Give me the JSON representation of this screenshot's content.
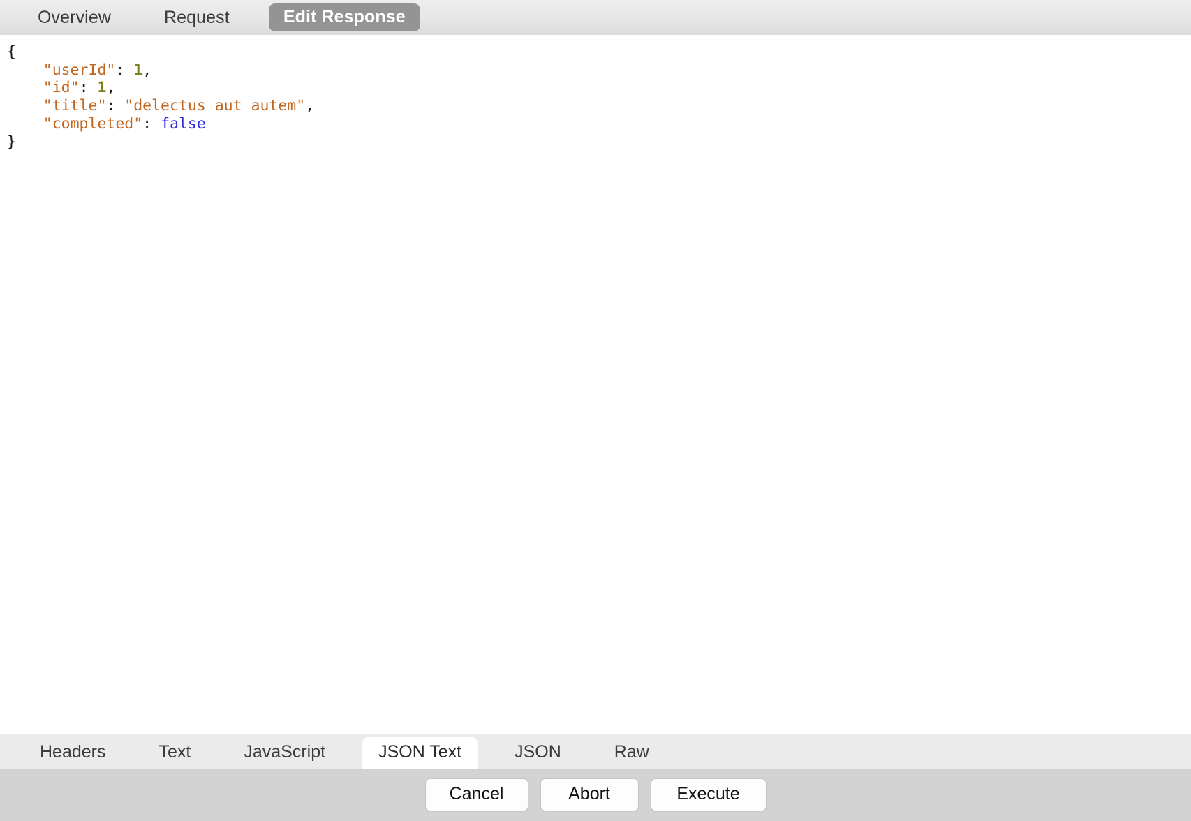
{
  "top_tabs": [
    {
      "label": "Overview",
      "active": false
    },
    {
      "label": "Request",
      "active": false
    },
    {
      "label": "Edit Response",
      "active": true
    }
  ],
  "editor": {
    "language": "json",
    "lines": [
      {
        "tokens": [
          {
            "t": "punct",
            "v": "{"
          }
        ]
      },
      {
        "tokens": [
          {
            "t": "punct",
            "v": "    "
          },
          {
            "t": "key",
            "v": "\"userId\""
          },
          {
            "t": "punct",
            "v": ": "
          },
          {
            "t": "num",
            "v": "1"
          },
          {
            "t": "punct",
            "v": ","
          }
        ]
      },
      {
        "tokens": [
          {
            "t": "punct",
            "v": "    "
          },
          {
            "t": "key",
            "v": "\"id\""
          },
          {
            "t": "punct",
            "v": ": "
          },
          {
            "t": "num",
            "v": "1"
          },
          {
            "t": "punct",
            "v": ","
          }
        ]
      },
      {
        "tokens": [
          {
            "t": "punct",
            "v": "    "
          },
          {
            "t": "key",
            "v": "\"title\""
          },
          {
            "t": "punct",
            "v": ": "
          },
          {
            "t": "str",
            "v": "\"delectus aut autem\""
          },
          {
            "t": "punct",
            "v": ","
          }
        ]
      },
      {
        "tokens": [
          {
            "t": "punct",
            "v": "    "
          },
          {
            "t": "key",
            "v": "\"completed\""
          },
          {
            "t": "punct",
            "v": ": "
          },
          {
            "t": "bool",
            "v": "false"
          }
        ]
      },
      {
        "tokens": [
          {
            "t": "punct",
            "v": "}"
          }
        ]
      }
    ],
    "plain_text": "{\n    \"userId\": 1,\n    \"id\": 1,\n    \"title\": \"delectus aut autem\",\n    \"completed\": false\n}"
  },
  "format_tabs": [
    {
      "label": "Headers",
      "active": false
    },
    {
      "label": "Text",
      "active": false
    },
    {
      "label": "JavaScript",
      "active": false
    },
    {
      "label": "JSON Text",
      "active": true
    },
    {
      "label": "JSON",
      "active": false
    },
    {
      "label": "Raw",
      "active": false
    }
  ],
  "footer_buttons": [
    {
      "label": "Cancel",
      "kind": "cancel"
    },
    {
      "label": "Abort",
      "kind": "abort"
    },
    {
      "label": "Execute",
      "kind": "execute"
    }
  ],
  "colors": {
    "top_bar_top": "#ededed",
    "top_bar_bottom": "#dcdcdc",
    "active_top_tab_bg": "#949494",
    "active_top_tab_fg": "#ffffff",
    "tab_strip_bg": "#ebebeb",
    "active_fmt_tab_bg": "#ffffff",
    "footer_bg": "#d3d3d3",
    "button_bg": "#fdfdfd",
    "editor_bg": "#ffffff",
    "syntax_key": "#c2651f",
    "syntax_string": "#c2651f",
    "syntax_number": "#7f7f1b",
    "syntax_boolean": "#2a2ae0",
    "syntax_punctuation": "#1b1b1b",
    "text_default": "#3c3c3c"
  }
}
